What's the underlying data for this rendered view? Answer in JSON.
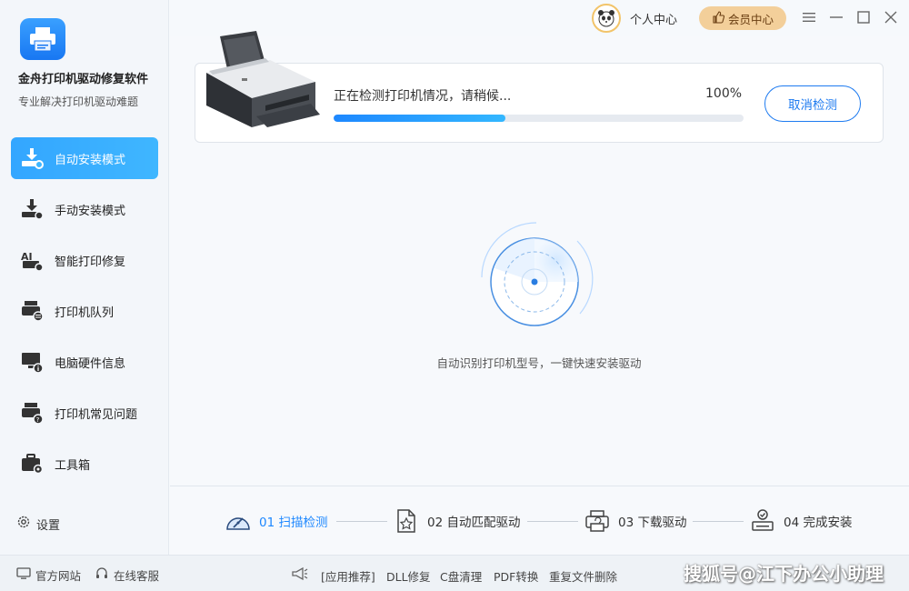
{
  "app": {
    "title": "金舟打印机驱动修复软件",
    "subtitle": "专业解决打印机驱动难题"
  },
  "sidebar": {
    "items": [
      {
        "label": "自动安装模式",
        "icon": "download-install-icon",
        "active": true
      },
      {
        "label": "手动安装模式",
        "icon": "manual-install-icon",
        "active": false
      },
      {
        "label": "智能打印修复",
        "icon": "ai-repair-icon",
        "active": false
      },
      {
        "label": "打印机队列",
        "icon": "printer-queue-icon",
        "active": false
      },
      {
        "label": "电脑硬件信息",
        "icon": "hardware-info-icon",
        "active": false
      },
      {
        "label": "打印机常见问题",
        "icon": "printer-faq-icon",
        "active": false
      },
      {
        "label": "工具箱",
        "icon": "toolbox-icon",
        "active": false
      }
    ],
    "settings_label": "设置"
  },
  "topbar": {
    "personal_label": "个人中心",
    "vip_label": "会员中心"
  },
  "scan": {
    "status_text": "正在检测打印机情况，请稍候...",
    "percent_text": "100%",
    "progress_fraction": 0.42,
    "cancel_label": "取消检测",
    "caption": "自动识别打印机型号，一键快速安装驱动"
  },
  "steps": [
    {
      "label": "01 扫描检测",
      "icon": "scan-gauge-icon",
      "active": true
    },
    {
      "label": "02 自动匹配驱动",
      "icon": "match-file-icon",
      "active": false
    },
    {
      "label": "03 下载驱动",
      "icon": "download-printer-icon",
      "active": false
    },
    {
      "label": "04 完成安装",
      "icon": "install-complete-icon",
      "active": false
    }
  ],
  "footer": {
    "website_label": "官方网站",
    "service_label": "在线客服",
    "links": [
      "[应用推荐]",
      "DLL修复",
      "C盘清理",
      "PDF转换",
      "重复文件删除"
    ],
    "watermark": "搜狐号@江下办公小助理"
  },
  "colors": {
    "accent": "#1e88ff",
    "active_nav": "#3fb6ff",
    "vip": "#f3cf9a"
  }
}
